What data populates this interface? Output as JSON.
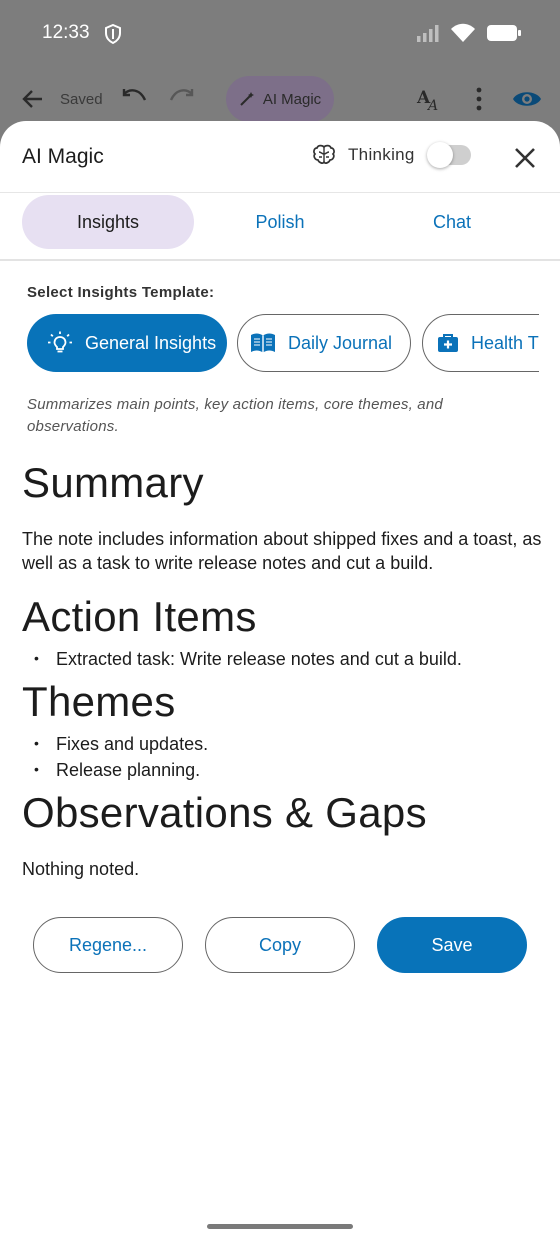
{
  "status_bar": {
    "time": "12:33"
  },
  "background_toolbar": {
    "saved_label": "Saved",
    "ai_magic_label": "AI Magic"
  },
  "sheet": {
    "title": "AI Magic",
    "thinking_label": "Thinking",
    "thinking_enabled": false,
    "tabs": [
      {
        "label": "Insights",
        "active": true
      },
      {
        "label": "Polish",
        "active": false
      },
      {
        "label": "Chat",
        "active": false
      }
    ],
    "template_label": "Select Insights Template:",
    "templates": [
      {
        "label": "General Insights",
        "icon": "lightbulb-icon",
        "selected": true
      },
      {
        "label": "Daily Journal",
        "icon": "book-icon",
        "selected": false
      },
      {
        "label": "Health T",
        "icon": "medical-kit-icon",
        "selected": false
      }
    ],
    "template_description": "Summarizes main points, key action items, core themes, and observations.",
    "result": {
      "summary_heading": "Summary",
      "summary_text": "The note includes information about shipped fixes and a toast, as well as a task to write release notes and cut a build.",
      "action_items_heading": "Action Items",
      "action_items": [
        "Extracted task: Write release notes and cut a build."
      ],
      "themes_heading": "Themes",
      "themes": [
        "Fixes and updates.",
        "Release planning."
      ],
      "observations_heading": "Observations & Gaps",
      "observations_text": "Nothing noted."
    },
    "buttons": {
      "regenerate_label": "Regene...",
      "copy_label": "Copy",
      "save_label": "Save"
    }
  },
  "colors": {
    "accent": "#0873b9",
    "active_tab_bg": "#e7e0f2",
    "scrim": "#7d7d7d"
  }
}
